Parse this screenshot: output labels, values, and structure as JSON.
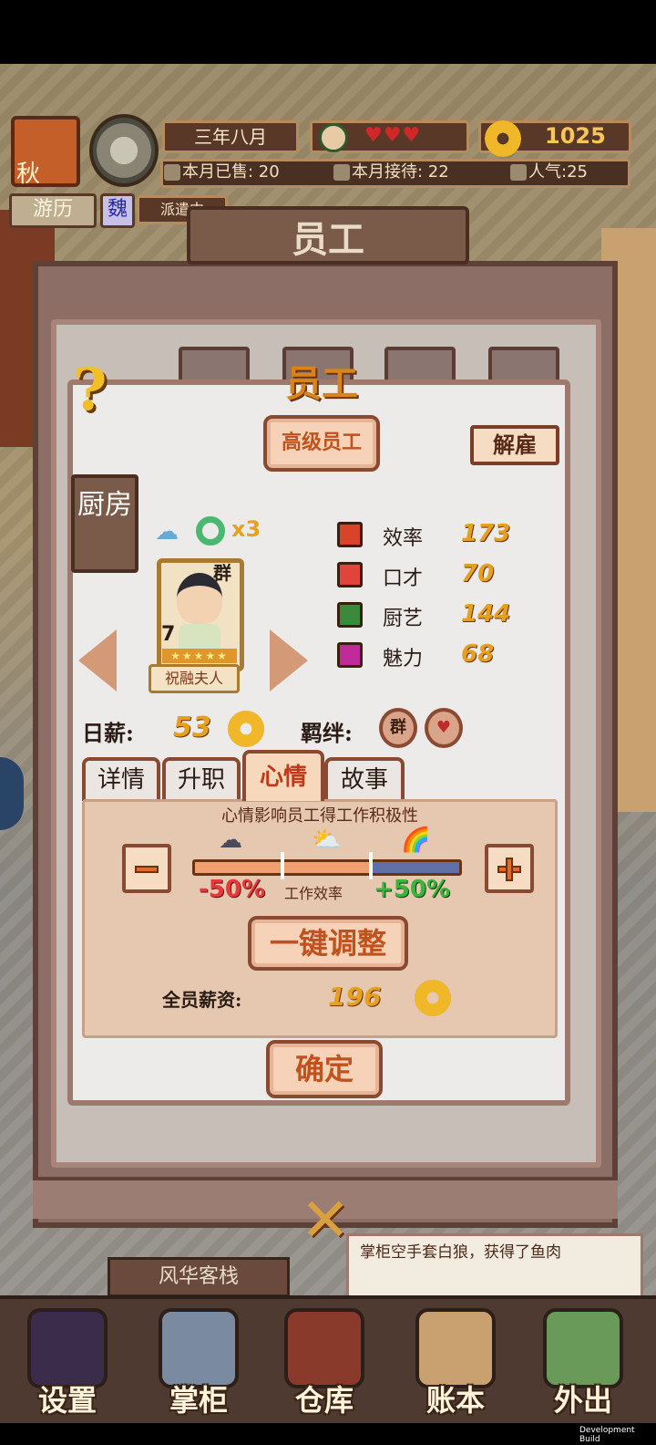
{
  "hud": {
    "season": "秋",
    "date": "三年八月",
    "hearts": "♥♥♥",
    "coins": "1025",
    "sold_this_month": "本月已售: 20",
    "received_this_month": "本月接待: 22",
    "popularity": "人气:25",
    "travel_label": "游历",
    "region_badge": "魏",
    "dispatch_status": "派遣中"
  },
  "background_panel": {
    "title": "员工"
  },
  "dialog": {
    "title": "员工",
    "help_icon": "?",
    "senior_staff_button": "高级员工",
    "fire_button": "解雇",
    "department_tab": "厨房",
    "buff_multiplier": "x3",
    "employee": {
      "name": "祝融夫人",
      "level": "7",
      "stars": "★★★★★",
      "bond_tag": "群"
    },
    "stats": [
      {
        "name": "效率",
        "value": "173",
        "color": "#d8442a"
      },
      {
        "name": "口才",
        "value": "70",
        "color": "#e0443a"
      },
      {
        "name": "厨艺",
        "value": "144",
        "color": "#3a8a3a"
      },
      {
        "name": "魅力",
        "value": "68",
        "color": "#c02a9a"
      }
    ],
    "daily_wage_label": "日薪:",
    "daily_wage_value": "53",
    "bond_label": "羁绊:",
    "bond_badges": [
      "群",
      "♥"
    ],
    "tabs": [
      "详情",
      "升职",
      "心情",
      "故事"
    ],
    "active_tab": "心情",
    "mood": {
      "description": "心情影响员工得工作积极性",
      "level": 0.66,
      "min_label": "-50%",
      "effect_label": "工作效率",
      "max_label": "+50%"
    },
    "adjust_all_button": "一键调整",
    "total_salary_label": "全员薪资:",
    "total_salary_value": "196",
    "confirm_button": "确定",
    "close_icon": "✕"
  },
  "bottom": {
    "inn_name": "风华客栈",
    "message": "掌柜空手套白狼，获得了鱼肉",
    "dock": [
      {
        "label": "设置",
        "icon": "yin-yang-settings-icon",
        "color": "#3a2c4a"
      },
      {
        "label": "掌柜",
        "icon": "shopkeeper-icon",
        "color": "#7a8aa0"
      },
      {
        "label": "仓库",
        "icon": "warehouse-chest-icon",
        "color": "#8a3a2a"
      },
      {
        "label": "账本",
        "icon": "ledger-scroll-icon",
        "color": "#c9a070"
      },
      {
        "label": "外出",
        "icon": "travel-bundle-icon",
        "color": "#6a9a5a"
      }
    ]
  },
  "dev_label": "Development Build"
}
